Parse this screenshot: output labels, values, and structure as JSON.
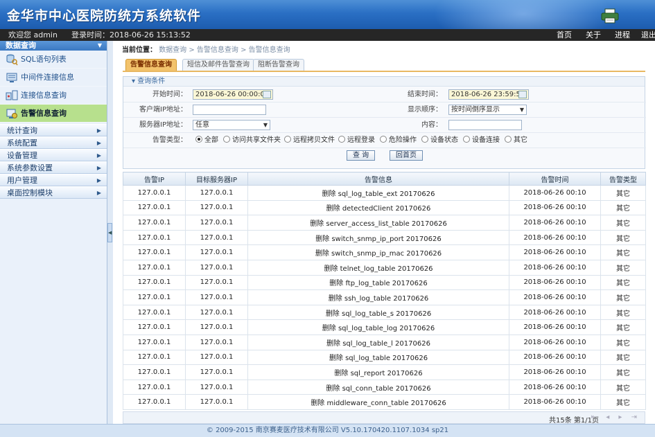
{
  "header": {
    "title": "金华市中心医院防统方系统软件"
  },
  "infobar": {
    "welcome": "欢迎您 admin",
    "login_time": "登录时间：2018-06-26 15:13:52",
    "nav": [
      "首页",
      "关于",
      "进程",
      "退出"
    ]
  },
  "sidebar": {
    "group_title": "数据查询",
    "items": [
      {
        "label": "SQL语句列表",
        "icon": "database-search-icon"
      },
      {
        "label": "中间件连接信息",
        "icon": "middleware-icon"
      },
      {
        "label": "连接信息查询",
        "icon": "connection-icon"
      },
      {
        "label": "告警信息查询",
        "icon": "alarm-icon"
      }
    ],
    "categories": [
      "统计查询",
      "系统配置",
      "设备管理",
      "系统参数设置",
      "用户管理",
      "桌面控制模块"
    ]
  },
  "breadcrumb": {
    "label": "当前位置：",
    "path": "数据查询 > 告警信息查询 > 告警信息查询"
  },
  "tabs": [
    "告警信息查询",
    "短信及邮件告警查询",
    "阻断告警查询"
  ],
  "filter": {
    "title": "查询条件",
    "start_label": "开始时间：",
    "start_value": "2018-06-26 00:00:00",
    "end_label": "结束时间：",
    "end_value": "2018-06-26 23:59:59",
    "client_ip_label": "客户端IP地址：",
    "client_ip_value": "",
    "order_label": "显示顺序：",
    "order_value": "按时间倒序显示",
    "server_ip_label": "服务器IP地址：",
    "server_ip_value": "任意",
    "content_label": "内容：",
    "content_value": "",
    "type_label": "告警类型：",
    "types": [
      "全部",
      "访问共享文件夹",
      "远程拷贝文件",
      "远程登录",
      "危险操作",
      "设备状态",
      "设备连接",
      "其它"
    ],
    "selected_type": "全部",
    "query_button": "查 询",
    "home_button": "回首页"
  },
  "table": {
    "columns": [
      "告警IP",
      "目标服务器IP",
      "告警信息",
      "告警时间",
      "告警类型"
    ],
    "rows": [
      [
        "127.0.0.1",
        "127.0.0.1",
        "删除 sql_log_table_ext 20170626",
        "2018-06-26 00:10",
        "其它"
      ],
      [
        "127.0.0.1",
        "127.0.0.1",
        "删除 detectedClient 20170626",
        "2018-06-26 00:10",
        "其它"
      ],
      [
        "127.0.0.1",
        "127.0.0.1",
        "删除 server_access_list_table 20170626",
        "2018-06-26 00:10",
        "其它"
      ],
      [
        "127.0.0.1",
        "127.0.0.1",
        "删除 switch_snmp_ip_port 20170626",
        "2018-06-26 00:10",
        "其它"
      ],
      [
        "127.0.0.1",
        "127.0.0.1",
        "删除 switch_snmp_ip_mac 20170626",
        "2018-06-26 00:10",
        "其它"
      ],
      [
        "127.0.0.1",
        "127.0.0.1",
        "删除 telnet_log_table 20170626",
        "2018-06-26 00:10",
        "其它"
      ],
      [
        "127.0.0.1",
        "127.0.0.1",
        "删除 ftp_log_table 20170626",
        "2018-06-26 00:10",
        "其它"
      ],
      [
        "127.0.0.1",
        "127.0.0.1",
        "删除 ssh_log_table 20170626",
        "2018-06-26 00:10",
        "其它"
      ],
      [
        "127.0.0.1",
        "127.0.0.1",
        "删除 sql_log_table_s 20170626",
        "2018-06-26 00:10",
        "其它"
      ],
      [
        "127.0.0.1",
        "127.0.0.1",
        "删除 sql_log_table_log 20170626",
        "2018-06-26 00:10",
        "其它"
      ],
      [
        "127.0.0.1",
        "127.0.0.1",
        "删除 sql_log_table_l 20170626",
        "2018-06-26 00:10",
        "其它"
      ],
      [
        "127.0.0.1",
        "127.0.0.1",
        "删除 sql_log_table 20170626",
        "2018-06-26 00:10",
        "其它"
      ],
      [
        "127.0.0.1",
        "127.0.0.1",
        "删除 sql_report 20170626",
        "2018-06-26 00:10",
        "其它"
      ],
      [
        "127.0.0.1",
        "127.0.0.1",
        "删除 sql_conn_table 20170626",
        "2018-06-26 00:10",
        "其它"
      ],
      [
        "127.0.0.1",
        "127.0.0.1",
        "删除 middleware_conn_table 20170626",
        "2018-06-26 00:10",
        "其它"
      ]
    ]
  },
  "pager": {
    "text": "共15条 第1/1页",
    "nav": "⇤ ◂ ▸ ⇥"
  },
  "footer": {
    "text": "© 2009-2015 南京赛麦医疗技术有限公司 V5.10.170420.1107.1034 sp21"
  },
  "colors": {
    "header": "#2a6fc4",
    "active_item": "#b7e08d",
    "active_tab": "#f3c36d"
  }
}
